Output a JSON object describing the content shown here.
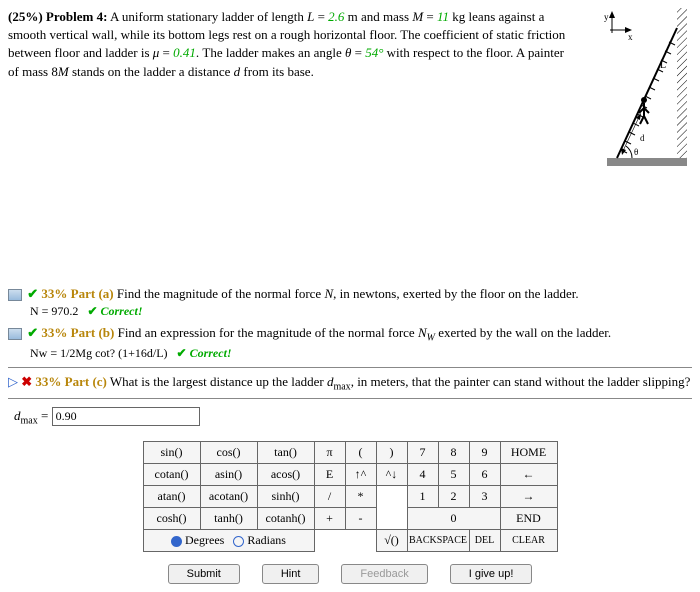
{
  "problem": {
    "weight": "(25%)",
    "label": "Problem 4:",
    "text1": "A uniform stationary ladder of length ",
    "L_eq": "L = 2.6",
    "text2": " m and mass ",
    "M_eq": "M = 11",
    "text3": " kg leans against a smooth vertical wall, while its bottom legs rest on a rough horizontal floor. The coefficient of static friction between floor and ladder is ",
    "mu_eq": "μ = 0.41",
    "text4": ". The ladder makes an angle ",
    "theta_eq": "θ = 54°",
    "text5": " with respect to the floor. A painter of mass 8",
    "M2": "M",
    "text6": " stands on the ladder a distance ",
    "d": "d",
    "text7": " from its base."
  },
  "figure": {
    "L": "L",
    "d": "d",
    "theta": "θ",
    "y": "y",
    "x": "x"
  },
  "parts": {
    "a": {
      "pct": "33% Part (a)",
      "q": "Find the magnitude of the normal force ",
      "N": "N",
      "q2": ", in newtons, exerted by the floor on the ladder.",
      "ans": "N = 970.2",
      "correct": "Correct!"
    },
    "b": {
      "pct": "33% Part (b)",
      "q": "Find an expression for the magnitude of the normal force ",
      "Nw": "N",
      "Nw_sub": "W",
      "q2": " exerted by the wall on the ladder.",
      "ans": "Nᴡ = 1/2Mg cot? (1+16d/L)",
      "correct": "Correct!"
    },
    "c": {
      "pct": "33% Part (c)",
      "q": "What is the largest distance up the ladder ",
      "dmax": "d",
      "dmax_sub": "max",
      "q2": ", in meters, that the painter can stand without the ladder slipping?",
      "lhs": "d",
      "lhs_sub": "max",
      "eq": " = ",
      "value": "0.90"
    }
  },
  "keypad": {
    "fns": [
      [
        "sin()",
        "cos()",
        "tan()"
      ],
      [
        "cotan()",
        "asin()",
        "acos()"
      ],
      [
        "atan()",
        "acotan()",
        "sinh()"
      ],
      [
        "cosh()",
        "tanh()",
        "cotanh()"
      ]
    ],
    "sym": [
      [
        "π",
        "(",
        ")"
      ],
      [
        "E",
        "↑^",
        "^↓"
      ],
      [
        "/",
        "*",
        ""
      ],
      [
        "+",
        "-",
        ""
      ]
    ],
    "num": [
      [
        "7",
        "8",
        "9"
      ],
      [
        "4",
        "5",
        "6"
      ],
      [
        "1",
        "2",
        "3"
      ],
      [
        "",
        "0",
        ""
      ]
    ],
    "side": [
      "HOME",
      "←",
      "→",
      "END"
    ],
    "bottom_sym": "√()",
    "bottom_back": "BACKSPACE",
    "bottom_del": "DEL",
    "bottom_clear": "CLEAR",
    "degrees": "Degrees",
    "radians": "Radians"
  },
  "buttons": {
    "submit": "Submit",
    "hint": "Hint",
    "feedback": "Feedback",
    "giveup": "I give up!"
  }
}
